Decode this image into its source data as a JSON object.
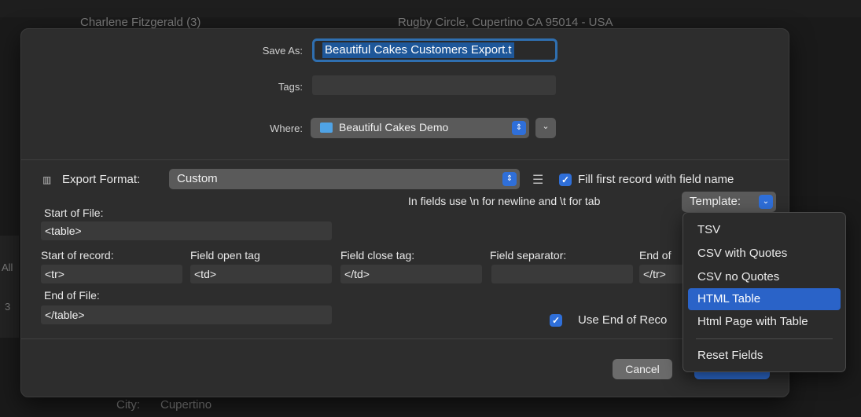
{
  "background": {
    "row1_name": "Charlene Fitzgerald (3)",
    "row1_address": "Rugby Circle, Cupertino  CA  95014  - USA",
    "left_fragment_1": "All",
    "left_fragment_2": "3",
    "bottom_label": "City:",
    "bottom_value": "Cupertino"
  },
  "save_sheet": {
    "save_as_label": "Save As:",
    "save_as_value": "Beautiful Cakes Customers Export.t",
    "tags_label": "Tags:",
    "tags_value": "",
    "where_label": "Where:",
    "where_value": "Beautiful Cakes Demo"
  },
  "export": {
    "format_label": "Export Format:",
    "format_value": "Custom",
    "fill_first_record_label": "Fill first record with field name",
    "hint": "In fields use \\n for newline and \\t for tab",
    "template_label": "Template:",
    "start_of_file_label": "Start of File:",
    "start_of_file_value": "<table>",
    "start_of_record_label": "Start of record:",
    "start_of_record_value": "<tr>",
    "field_open_tag_label": "Field open tag",
    "field_open_tag_value": "<td>",
    "field_close_tag_label": "Field close tag:",
    "field_close_tag_value": "</td>",
    "field_separator_label": "Field separator:",
    "field_separator_value": "",
    "end_of_record_label": "End of",
    "end_of_record_value": "</tr>",
    "end_of_file_label": "End of File:",
    "end_of_file_value": "</table>",
    "use_end_of_record_label": "Use End of Reco"
  },
  "buttons": {
    "cancel": "Cancel"
  },
  "template_menu": {
    "items": [
      "TSV",
      "CSV with Quotes",
      "CSV no Quotes",
      "HTML Table",
      "Html Page with Table"
    ],
    "selected": "HTML Table",
    "reset": "Reset Fields"
  },
  "colors": {
    "accent": "#2f6fd9",
    "selection": "#2a63c8",
    "sheet_bg": "#2d2d2d"
  }
}
